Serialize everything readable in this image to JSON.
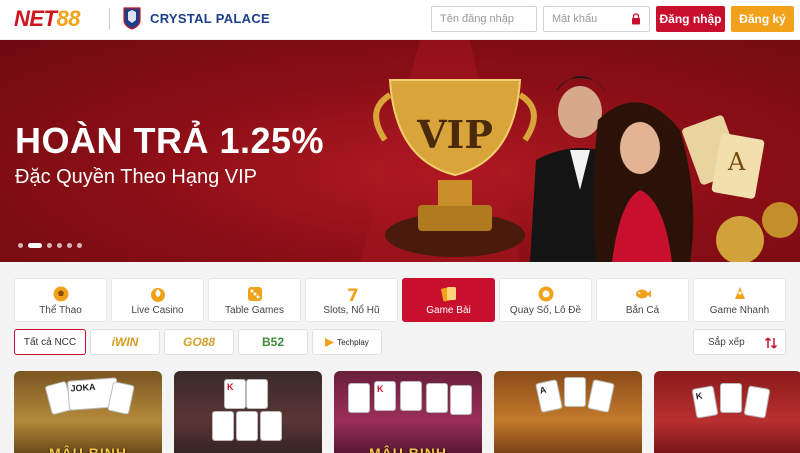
{
  "header": {
    "logo_main": "NET",
    "logo_num": "88",
    "partner": "CRYSTAL PALACE",
    "username_placeholder": "Tên đăng nhập",
    "password_placeholder": "Mật khẩu",
    "login_label": "Đăng nhập",
    "register_label": "Đăng ký"
  },
  "banner": {
    "title": "HOÀN TRẢ 1.25%",
    "subtitle": "Đặc Quyền Theo Hạng VIP",
    "trophy_text": "VIP",
    "slide_count": 6,
    "active_slide": 1
  },
  "categories": [
    {
      "label": "Thể Thao",
      "icon": "soccer-ball-icon"
    },
    {
      "label": "Live Casino",
      "icon": "spade-chip-icon"
    },
    {
      "label": "Table Games",
      "icon": "dice-icon"
    },
    {
      "label": "Slots, Nổ Hũ",
      "icon": "seven-icon"
    },
    {
      "label": "Game Bài",
      "icon": "cards-icon",
      "active": true
    },
    {
      "label": "Quay Số, Lô Đề",
      "icon": "lottery-ball-icon"
    },
    {
      "label": "Bắn Cá",
      "icon": "fish-icon"
    },
    {
      "label": "Game Nhanh",
      "icon": "rocket-icon"
    }
  ],
  "providers": {
    "all": "Tất cả NCC",
    "p1": "iWIN",
    "p2": "GO88",
    "p3": "B52",
    "p4": "Techplay"
  },
  "sort_label": "Sắp xếp",
  "games": [
    {
      "caption": "MẬU BINH",
      "card": "JOKA"
    },
    {
      "caption": "",
      "card": "K"
    },
    {
      "caption": "MẬU BINH",
      "card": "K"
    },
    {
      "caption": "",
      "card": "A"
    },
    {
      "caption": "",
      "card": "K"
    }
  ],
  "colors": {
    "brand_red": "#c8102e",
    "accent_orange": "#f2a21a",
    "partner_blue": "#1b3f8b"
  }
}
